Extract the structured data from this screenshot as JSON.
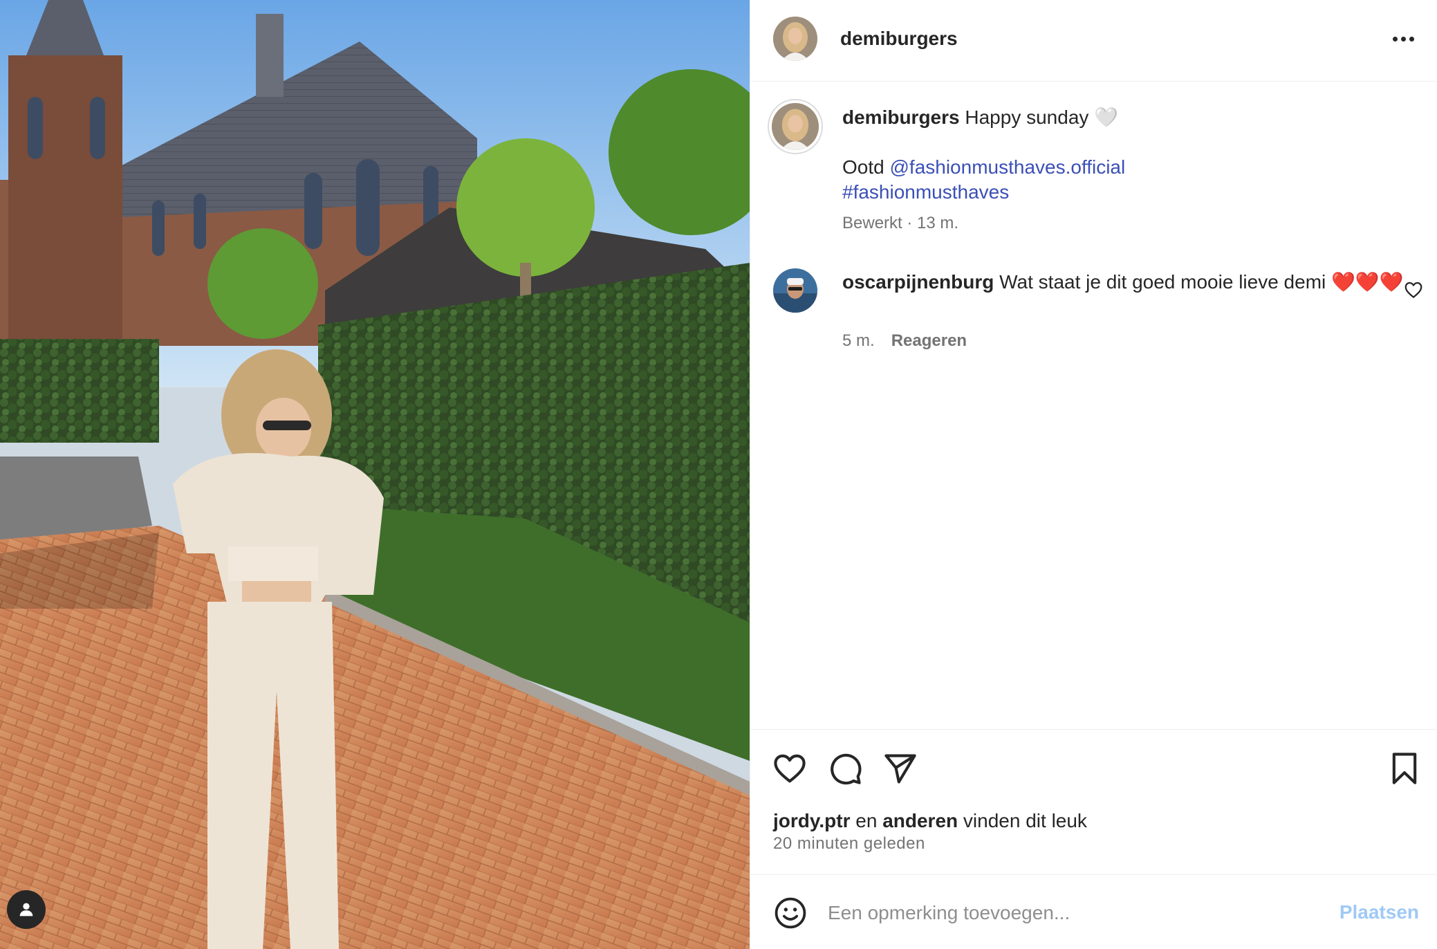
{
  "post": {
    "author": "demiburgers",
    "caption": {
      "username": "demiburgers",
      "text": "Happy sunday 🤍",
      "line2_prefix": "Ootd",
      "mention": "@fashionmusthaves.official",
      "hashtag": "#fashionmusthaves",
      "meta": "Bewerkt · 13 m."
    },
    "comments": [
      {
        "username": "oscarpijnenburg",
        "text": "Wat staat je dit goed mooie lieve demi ❤️❤️❤️",
        "time": "5 m.",
        "reply_label": "Reageren"
      }
    ],
    "likes": {
      "first_user": "jordy.ptr",
      "connector": "en",
      "others": "anderen",
      "suffix": "vinden dit leuk"
    },
    "posted_time": "20 minuten geleden"
  },
  "composer": {
    "placeholder": "Een opmerking toevoegen...",
    "post_label": "Plaatsen"
  },
  "icons": {
    "more": "more-horizontal-icon",
    "like": "heart-icon",
    "comment": "comment-bubble-icon",
    "share": "paper-plane-icon",
    "save": "bookmark-icon",
    "emoji": "emoji-smile-icon",
    "tag": "user-tag-icon"
  },
  "colors": {
    "link": "#3b4fb6",
    "post_button_disabled": "#9fc9f5",
    "secondary_text": "#737373",
    "divider": "#efefef"
  }
}
